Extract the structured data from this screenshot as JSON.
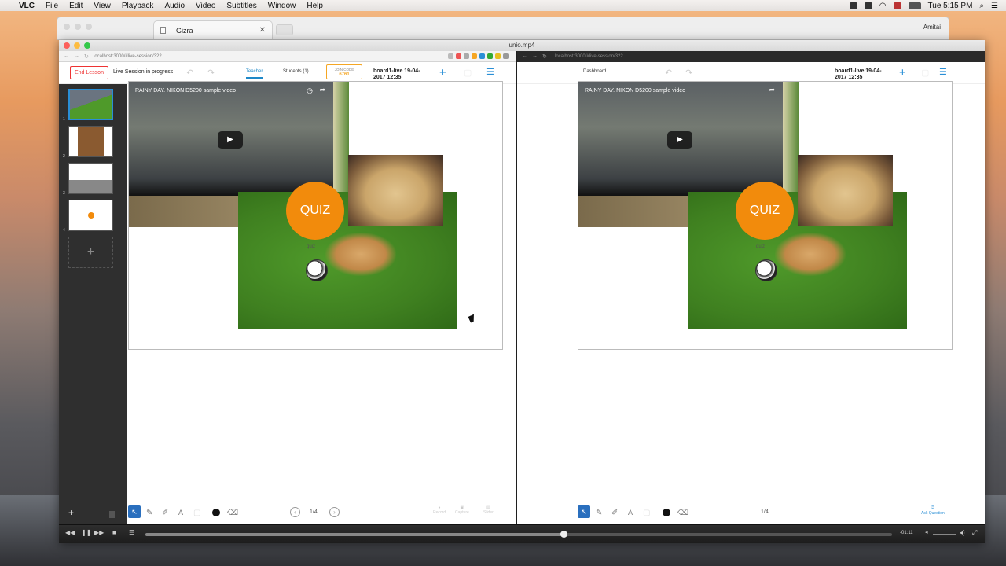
{
  "menubar": {
    "app": "VLC",
    "items": [
      "File",
      "Edit",
      "View",
      "Playback",
      "Audio",
      "Video",
      "Subtitles",
      "Window",
      "Help"
    ],
    "time": "Tue 5:15 PM"
  },
  "browser_bg": {
    "tab_title": "Gizra",
    "user": "Amitai"
  },
  "vlc": {
    "title": "unio.mp4",
    "time_remaining": "-01:11",
    "progress": 0.56
  },
  "teacher": {
    "url": "localhost:3000/#live-session/322",
    "end_lesson": "End Lesson",
    "status": "Live Session in progress",
    "tab_teacher": "Teacher",
    "tab_students": "Students (1)",
    "join_label": "JOIN CODE",
    "join_code": "6761",
    "board_title_1": "board1-live 19-04-",
    "board_title_2": "2017 12:35",
    "page": "1/4",
    "thumb_numbers": [
      "1",
      "2",
      "3",
      "4"
    ],
    "bottom_faint": [
      "Record",
      "Capture",
      "Slider"
    ]
  },
  "student": {
    "url": "localhost:3000/#live-session/322",
    "dashboard": "Dashboard",
    "board_title_1": "board1-live 19-04-",
    "board_title_2": "2017 12:35",
    "page": "1/4",
    "ask_question": "Ask Question"
  },
  "canvas": {
    "video_title": "RAINY DAY. NIKON D5200 sample video",
    "quiz": "QUIZ",
    "quiz_label": "quiz"
  }
}
